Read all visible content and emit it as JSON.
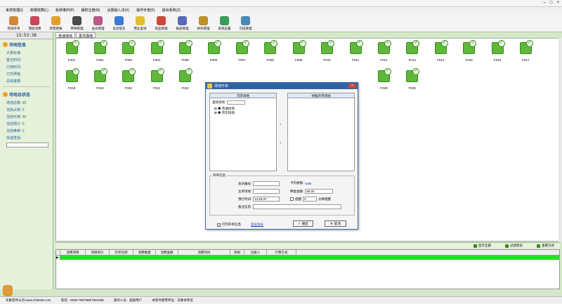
{
  "menu": [
    "来宾管理(I)",
    "收银结算(L)",
    "系统维护(P)",
    "版权注册(R)",
    "设置输入法(X)",
    "操作手册(F)",
    "退出系统(Z)"
  ],
  "toolbar": [
    {
      "label": "场地开单",
      "color": "#d08a3a"
    },
    {
      "label": "增加消费",
      "color": "#c8475a"
    },
    {
      "label": "宾客结帐",
      "color": "#e0a030"
    },
    {
      "label": "转钟管理",
      "color": "#4a4a4a"
    },
    {
      "label": "会员管理",
      "color": "#b55a8a"
    },
    {
      "label": "前台帮东",
      "color": "#3a7ad0"
    },
    {
      "label": "营业查询",
      "color": "#e0c030"
    },
    {
      "label": "商品管理",
      "color": "#c84a3a"
    },
    {
      "label": "报表管理",
      "color": "#5a6ab5"
    },
    {
      "label": "财务管理",
      "color": "#c0902a"
    },
    {
      "label": "系统设置",
      "color": "#3a9a5a"
    },
    {
      "label": "交班管理",
      "color": "#4a8ab5"
    }
  ],
  "clock": "13:53:38",
  "left": {
    "section1": "场地信息",
    "info1": [
      "计费标准:",
      "登记时间:",
      "已用时间:",
      "已交押金:",
      "总收金额:"
    ],
    "section2": "场地总状态",
    "info2": [
      {
        "label": "场地总数:",
        "value": "60"
      },
      {
        "label": "当前占用:",
        "value": "0"
      },
      {
        "label": "当前可用:",
        "value": "60"
      },
      {
        "label": "当前预订:",
        "value": "0"
      },
      {
        "label": "当前维修:",
        "value": "0"
      }
    ],
    "quick_search": "快速查找:"
  },
  "tabs": [
    "普通场地",
    "贵华场地"
  ],
  "venues_row1": [
    "F001",
    "F002",
    "F003",
    "F004",
    "F005",
    "F006",
    "F007",
    "F008",
    "F009",
    "F010",
    "F011",
    "F012",
    "F013",
    "F014",
    "F015",
    "F016",
    "F017"
  ],
  "venues_row2": [
    "F018",
    "F019",
    "F020",
    "F021",
    "F022",
    "F029",
    "F030"
  ],
  "bottom_actions": [
    "显示全部",
    "过滤状态",
    "查看方式"
  ],
  "table_headers": [
    "消费项目",
    "项目单价",
    "打折比例",
    "消费数量",
    "消费金额",
    "消费时间",
    "场地",
    "记帐人",
    "计费方式"
  ],
  "status": [
    "天象软件公司 www.chle828.com",
    "电话：0635-7987985/7364058",
    "操作人员：超级用户",
    "本软件使用单位：天象体育馆"
  ],
  "dialog": {
    "title": "场地开单",
    "left_panel_title": "可开场地",
    "find_label": "查找场地:",
    "tree": [
      "普通场地",
      "贵华场地"
    ],
    "right_panel_title": "待备开单场地",
    "group_title": "开单信息",
    "member_no_label": "会员编号:",
    "card_balance_label": "卡内余额:",
    "card_balance_value": "0.00",
    "host_venue_label": "主单场地:",
    "deposit_label": "押金金额:",
    "deposit_value": "¥0.00",
    "booking_time_label": "预订时间:",
    "booking_time_value": "14:53:37",
    "remind_label": "提醒",
    "remind_value": "0",
    "minutes_label": "分钟提醒",
    "remark_label": "备注信息:",
    "print_label": "打印开单信息",
    "verify_link": "验证会员",
    "ok_label": "确定",
    "cancel_label": "取消"
  }
}
